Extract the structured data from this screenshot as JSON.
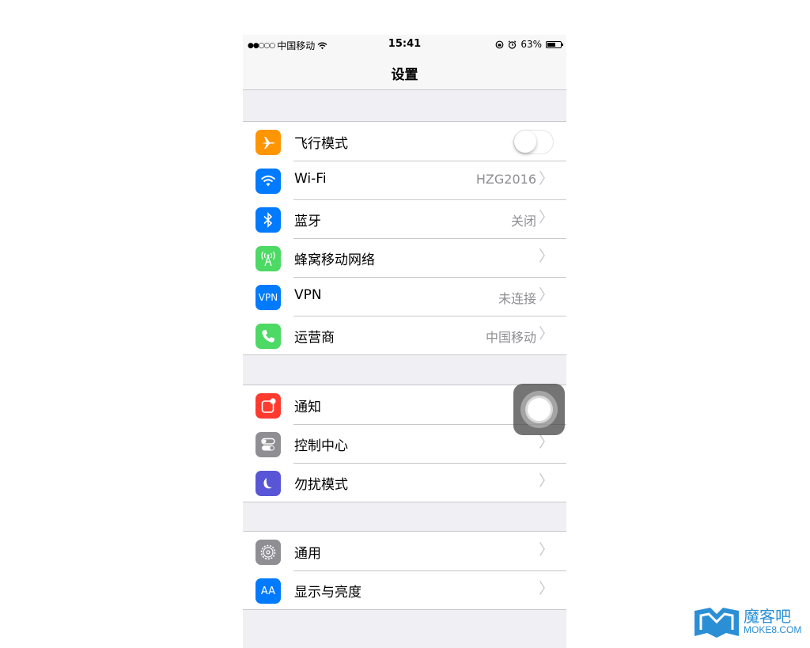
{
  "status_bar": {
    "signal": "●●○○○",
    "carrier": "中国移动",
    "time": "15:41",
    "battery": "63%",
    "battery_level": 0.63
  },
  "nav": {
    "title": "设置"
  },
  "groups": [
    [
      {
        "label": "飞行模式",
        "icon": "airplane-icon",
        "color": "#ff9500",
        "toggle": false
      },
      {
        "label": "Wi-Fi",
        "value": "HZG2016",
        "icon": "wifi-icon",
        "color": "#007aff"
      },
      {
        "label": "蓝牙",
        "value": "关闭",
        "icon": "bluetooth-icon",
        "color": "#007aff"
      },
      {
        "label": "蜂窝移动网络",
        "value": "",
        "icon": "cellular-icon",
        "color": "#4cd964"
      },
      {
        "label": "VPN",
        "value": "未连接",
        "icon": "vpn-icon",
        "color": "#007aff",
        "icon_text": "VPN"
      },
      {
        "label": "运营商",
        "value": "中国移动",
        "icon": "phone-icon",
        "color": "#4cd964"
      }
    ],
    [
      {
        "label": "通知",
        "icon": "notifications-icon",
        "color": "#ff3b30"
      },
      {
        "label": "控制中心",
        "icon": "control-center-icon",
        "color": "#8e8e93"
      },
      {
        "label": "勿扰模式",
        "icon": "moon-icon",
        "color": "#5856d6"
      }
    ],
    [
      {
        "label": "通用",
        "icon": "gear-icon",
        "color": "#8e8e93"
      },
      {
        "label": "显示与亮度",
        "icon": "display-icon",
        "color": "#007aff",
        "icon_text": "AA"
      }
    ]
  ],
  "watermark": {
    "cn": "魔客吧",
    "en": "MOKE8.COM"
  },
  "chevron": "〉"
}
